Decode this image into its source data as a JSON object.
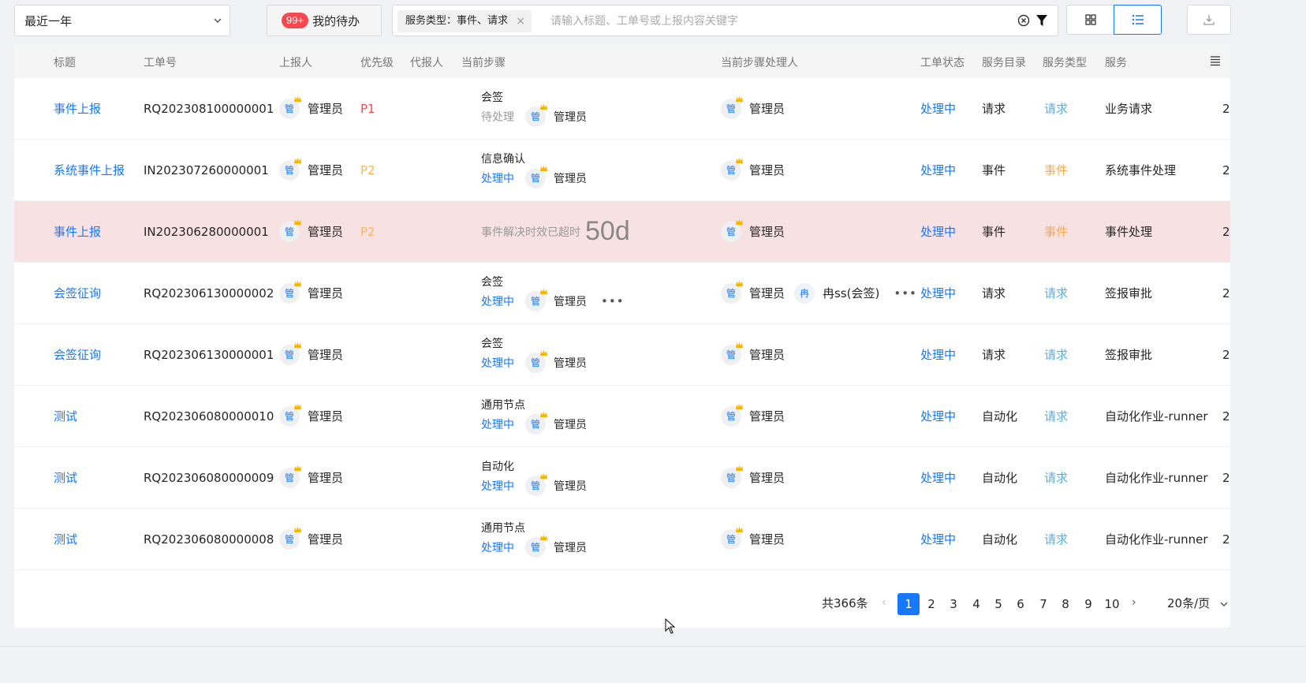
{
  "toolbar": {
    "range_value": "最近一年",
    "todo_badge": "99+",
    "todo_label": "我的待办",
    "filter_tag": "服务类型：事件、请求",
    "search_placeholder": "请输入标题、工单号或上报内容关键字"
  },
  "columns": [
    "标题",
    "工单号",
    "上报人",
    "优先级",
    "代报人",
    "当前步骤",
    "当前步骤处理人",
    "工单状态",
    "服务目录",
    "服务类型",
    "服务"
  ],
  "avatar_char": "管",
  "avatar_char_2": "冉",
  "rows": [
    {
      "title": "事件上报",
      "id": "RQ202308100000001",
      "reporter": "管理员",
      "priority": "P1",
      "step_name": "会签",
      "step_state": "待处理",
      "step_user": "管理员",
      "handler": "管理员",
      "status": "处理中",
      "catalog": "请求",
      "type": "请求",
      "service": "业务请求",
      "cut": "2"
    },
    {
      "title": "系统事件上报",
      "id": "IN202307260000001",
      "reporter": "管理员",
      "priority": "P2",
      "step_name": "信息确认",
      "step_state": "处理中",
      "step_user": "管理员",
      "handler": "管理员",
      "status": "处理中",
      "catalog": "事件",
      "type": "事件",
      "service": "系统事件处理",
      "cut": "2"
    },
    {
      "title": "事件上报",
      "id": "IN202306280000001",
      "reporter": "管理员",
      "priority": "P2",
      "overdue_text": "事件解决时效已超时",
      "overdue_days": "50d",
      "handler": "管理员",
      "status": "处理中",
      "catalog": "事件",
      "type": "事件",
      "service": "事件处理",
      "cut": "2"
    },
    {
      "title": "会签征询",
      "id": "RQ202306130000002",
      "reporter": "管理员",
      "priority": "",
      "step_name": "会签",
      "step_state": "处理中",
      "step_user": "管理员",
      "handler": "管理员",
      "handler2": "冉ss(会签)",
      "status": "处理中",
      "catalog": "请求",
      "type": "请求",
      "service": "签报审批",
      "cut": "2"
    },
    {
      "title": "会签征询",
      "id": "RQ202306130000001",
      "reporter": "管理员",
      "priority": "",
      "step_name": "会签",
      "step_state": "处理中",
      "step_user": "管理员",
      "handler": "管理员",
      "status": "处理中",
      "catalog": "请求",
      "type": "请求",
      "service": "签报审批",
      "cut": "2"
    },
    {
      "title": "测试",
      "id": "RQ202306080000010",
      "reporter": "管理员",
      "priority": "",
      "step_name": "通用节点",
      "step_state": "处理中",
      "step_user": "管理员",
      "handler": "管理员",
      "status": "处理中",
      "catalog": "自动化",
      "type": "请求",
      "service": "自动化作业-runner",
      "cut": "2"
    },
    {
      "title": "测试",
      "id": "RQ202306080000009",
      "reporter": "管理员",
      "priority": "",
      "step_name": "自动化",
      "step_state": "处理中",
      "step_user": "管理员",
      "handler": "管理员",
      "status": "处理中",
      "catalog": "自动化",
      "type": "请求",
      "service": "自动化作业-runner",
      "cut": "2"
    },
    {
      "title": "测试",
      "id": "RQ202306080000008",
      "reporter": "管理员",
      "priority": "",
      "step_name": "通用节点",
      "step_state": "处理中",
      "step_user": "管理员",
      "handler": "管理员",
      "status": "处理中",
      "catalog": "自动化",
      "type": "请求",
      "service": "自动化作业-runner",
      "cut": "2"
    }
  ],
  "pagination": {
    "total": "共366条",
    "pages": [
      "1",
      "2",
      "3",
      "4",
      "5",
      "6",
      "7",
      "8",
      "9",
      "10"
    ],
    "current": "1",
    "page_size": "20条/页"
  },
  "colors": {
    "accent": "#1677ff",
    "p1": "#f5484f",
    "p2": "#f8b84e",
    "overdue_row": "#f8e1e3"
  }
}
